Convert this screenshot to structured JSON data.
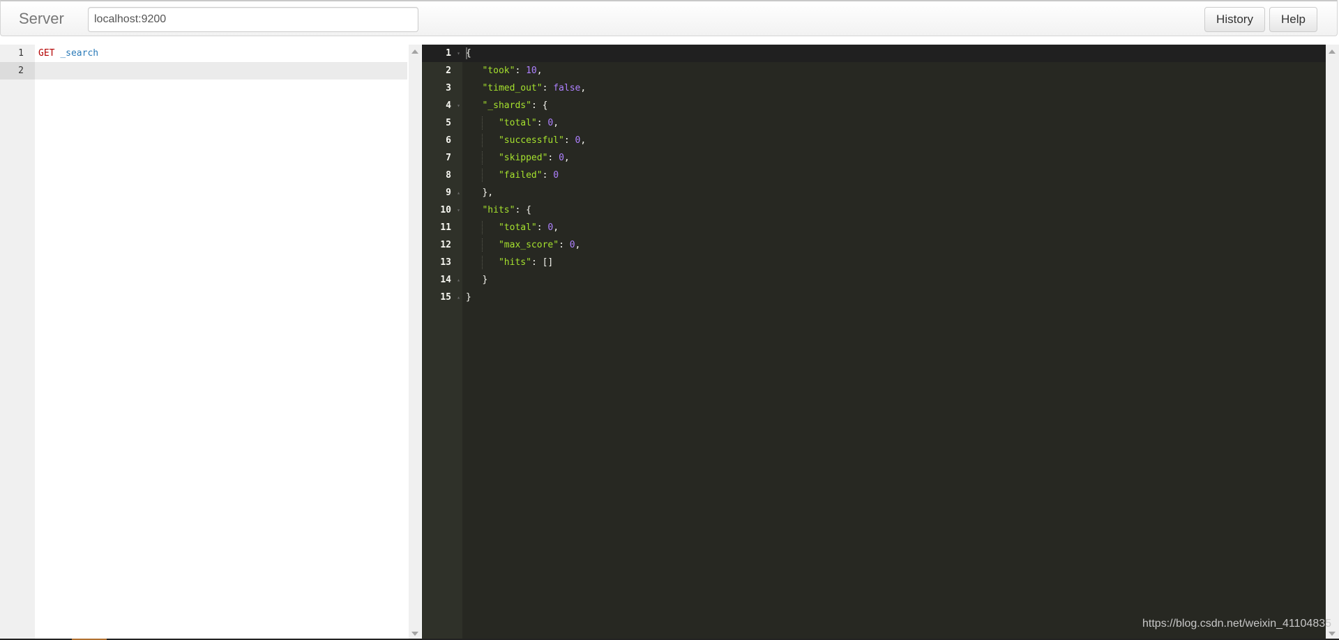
{
  "navbar": {
    "brand": "Server",
    "server_input_value": "localhost:9200",
    "buttons": {
      "history": "History",
      "help": "Help"
    }
  },
  "request_editor": {
    "line_numbers": [
      "1",
      "2"
    ],
    "active_line": 2,
    "lines": [
      {
        "method": "GET",
        "path": "_search"
      },
      {
        "method": "",
        "path": ""
      }
    ]
  },
  "response_editor": {
    "active_line": 1,
    "lines": [
      {
        "n": "1",
        "fold": "down",
        "indent": 0,
        "text": "{"
      },
      {
        "n": "2",
        "fold": "",
        "indent": 1,
        "key": "\"took\"",
        "value": "10",
        "tail": ","
      },
      {
        "n": "3",
        "fold": "",
        "indent": 1,
        "key": "\"timed_out\"",
        "value": "false",
        "tail": ","
      },
      {
        "n": "4",
        "fold": "down",
        "indent": 1,
        "key": "\"_shards\"",
        "value": "",
        "tail": "{"
      },
      {
        "n": "5",
        "fold": "",
        "indent": 2,
        "key": "\"total\"",
        "value": "0",
        "tail": ","
      },
      {
        "n": "6",
        "fold": "",
        "indent": 2,
        "key": "\"successful\"",
        "value": "0",
        "tail": ","
      },
      {
        "n": "7",
        "fold": "",
        "indent": 2,
        "key": "\"skipped\"",
        "value": "0",
        "tail": ","
      },
      {
        "n": "8",
        "fold": "",
        "indent": 2,
        "key": "\"failed\"",
        "value": "0",
        "tail": ""
      },
      {
        "n": "9",
        "fold": "up",
        "indent": 1,
        "text": "},"
      },
      {
        "n": "10",
        "fold": "down",
        "indent": 1,
        "key": "\"hits\"",
        "value": "",
        "tail": "{"
      },
      {
        "n": "11",
        "fold": "",
        "indent": 2,
        "key": "\"total\"",
        "value": "0",
        "tail": ","
      },
      {
        "n": "12",
        "fold": "",
        "indent": 2,
        "key": "\"max_score\"",
        "value": "0",
        "tail": ","
      },
      {
        "n": "13",
        "fold": "",
        "indent": 2,
        "key": "\"hits\"",
        "value": "",
        "tail": "[]"
      },
      {
        "n": "14",
        "fold": "up",
        "indent": 1,
        "text": "}"
      },
      {
        "n": "15",
        "fold": "up",
        "indent": 0,
        "text": "}"
      }
    ]
  },
  "watermark": "https://blog.csdn.net/weixin_41104835",
  "icons": {
    "scroll_up": "triangle-up",
    "scroll_down": "triangle-down",
    "fold_open": "▾",
    "fold_close": "▴"
  }
}
